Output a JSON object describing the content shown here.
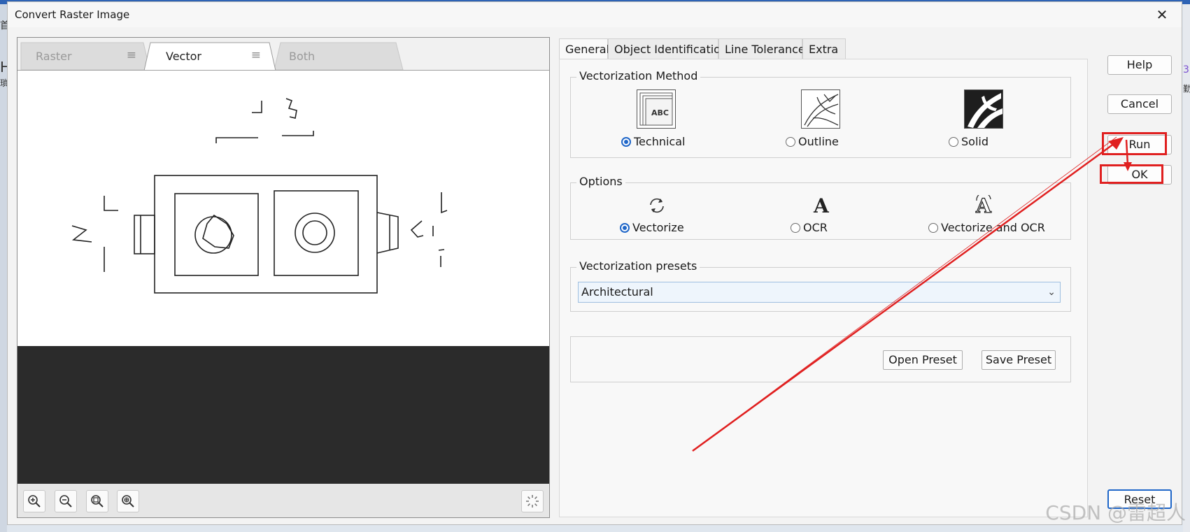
{
  "window": {
    "title": "Convert Raster Image",
    "close_glyph": "✕"
  },
  "background": {
    "left_glyphs": [
      "首",
      "H",
      "瑣"
    ],
    "right_glyphs": [
      "3",
      "勤"
    ]
  },
  "preview_tabs": [
    {
      "label": "Raster",
      "active": false
    },
    {
      "label": "Vector",
      "active": true
    },
    {
      "label": "Both",
      "active": false
    }
  ],
  "tab_menu_glyph": "≡",
  "preview_toolbar": {
    "buttons": [
      "zoom-in-icon",
      "zoom-out-icon",
      "zoom-fit-icon",
      "zoom-selection-icon"
    ],
    "right_icon": "loading-icon"
  },
  "option_tabs": [
    "General",
    "Object Identification",
    "Line Tolerance",
    "Extra"
  ],
  "active_option_tab": "General",
  "vectorization_method": {
    "title": "Vectorization Method",
    "options": [
      {
        "label": "Technical",
        "checked": true,
        "thumb_text": "ABC"
      },
      {
        "label": "Outline",
        "checked": false
      },
      {
        "label": "Solid",
        "checked": false
      }
    ]
  },
  "options_group": {
    "title": "Options",
    "options": [
      {
        "label": "Vectorize",
        "checked": true
      },
      {
        "label": "OCR",
        "checked": false
      },
      {
        "label": "Vectorize and OCR",
        "checked": false
      }
    ]
  },
  "presets": {
    "title": "Vectorization presets",
    "selected": "Architectural",
    "chevron": "⌄"
  },
  "preset_buttons": {
    "open": "Open Preset",
    "save": "Save Preset"
  },
  "side_buttons": {
    "help": "Help",
    "cancel": "Cancel",
    "run": "Run",
    "ok": "OK",
    "reset": "Reset"
  },
  "annotation": {
    "color": "#e02020"
  },
  "watermark": "CSDN @雷超人"
}
